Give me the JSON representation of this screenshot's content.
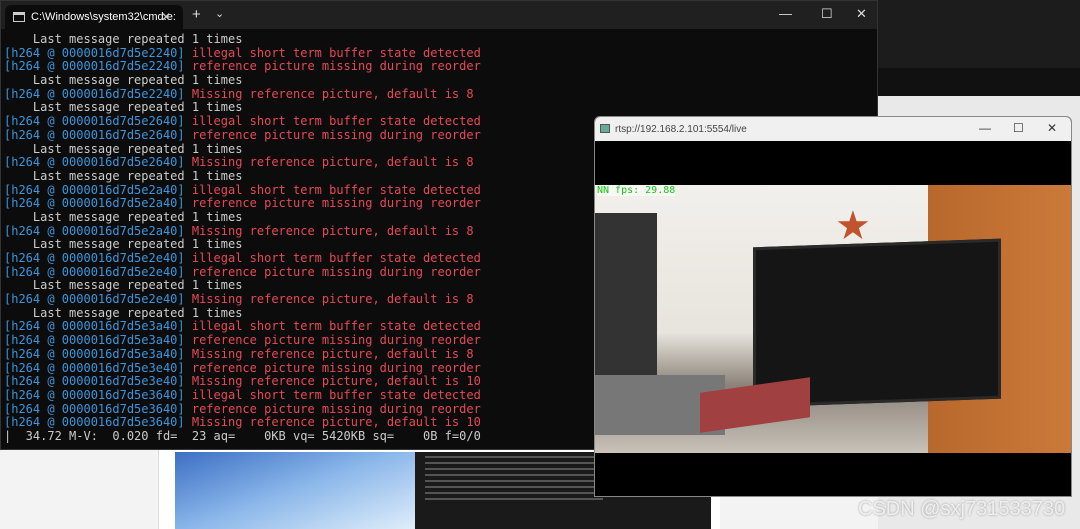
{
  "terminal": {
    "tab_title": "C:\\Windows\\system32\\cmd.e:",
    "lines": [
      {
        "p": "",
        "m": "",
        "g": "    Last message repeated 1 times"
      },
      {
        "p": "[h264 @ 0000016d7d5e2240] ",
        "m": "illegal short term buffer state detected",
        "g": ""
      },
      {
        "p": "[h264 @ 0000016d7d5e2240] ",
        "m": "reference picture missing during reorder",
        "g": ""
      },
      {
        "p": "",
        "m": "",
        "g": "    Last message repeated 1 times"
      },
      {
        "p": "[h264 @ 0000016d7d5e2240] ",
        "m": "Missing reference picture, default is 8",
        "g": ""
      },
      {
        "p": "",
        "m": "",
        "g": "    Last message repeated 1 times"
      },
      {
        "p": "[h264 @ 0000016d7d5e2640] ",
        "m": "illegal short term buffer state detected",
        "g": ""
      },
      {
        "p": "[h264 @ 0000016d7d5e2640] ",
        "m": "reference picture missing during reorder",
        "g": ""
      },
      {
        "p": "",
        "m": "",
        "g": "    Last message repeated 1 times"
      },
      {
        "p": "[h264 @ 0000016d7d5e2640] ",
        "m": "Missing reference picture, default is 8",
        "g": ""
      },
      {
        "p": "",
        "m": "",
        "g": "    Last message repeated 1 times"
      },
      {
        "p": "[h264 @ 0000016d7d5e2a40] ",
        "m": "illegal short term buffer state detected",
        "g": ""
      },
      {
        "p": "[h264 @ 0000016d7d5e2a40] ",
        "m": "reference picture missing during reorder",
        "g": ""
      },
      {
        "p": "",
        "m": "",
        "g": "    Last message repeated 1 times"
      },
      {
        "p": "[h264 @ 0000016d7d5e2a40] ",
        "m": "Missing reference picture, default is 8",
        "g": ""
      },
      {
        "p": "",
        "m": "",
        "g": "    Last message repeated 1 times"
      },
      {
        "p": "[h264 @ 0000016d7d5e2e40] ",
        "m": "illegal short term buffer state detected",
        "g": ""
      },
      {
        "p": "[h264 @ 0000016d7d5e2e40] ",
        "m": "reference picture missing during reorder",
        "g": ""
      },
      {
        "p": "",
        "m": "",
        "g": "    Last message repeated 1 times"
      },
      {
        "p": "[h264 @ 0000016d7d5e2e40] ",
        "m": "Missing reference picture, default is 8",
        "g": ""
      },
      {
        "p": "",
        "m": "",
        "g": "    Last message repeated 1 times"
      },
      {
        "p": "[h264 @ 0000016d7d5e3a40] ",
        "m": "illegal short term buffer state detected",
        "g": ""
      },
      {
        "p": "[h264 @ 0000016d7d5e3a40] ",
        "m": "reference picture missing during reorder",
        "g": ""
      },
      {
        "p": "[h264 @ 0000016d7d5e3a40] ",
        "m": "Missing reference picture, default is 8",
        "g": ""
      },
      {
        "p": "[h264 @ 0000016d7d5e3e40] ",
        "m": "reference picture missing during reorder",
        "g": ""
      },
      {
        "p": "[h264 @ 0000016d7d5e3e40] ",
        "m": "Missing reference picture, default is 10",
        "g": ""
      },
      {
        "p": "[h264 @ 0000016d7d5e3640] ",
        "m": "illegal short term buffer state detected",
        "g": ""
      },
      {
        "p": "[h264 @ 0000016d7d5e3640] ",
        "m": "reference picture missing during reorder",
        "g": ""
      },
      {
        "p": "[h264 @ 0000016d7d5e3640] ",
        "m": "Missing reference picture, default is 10",
        "g": ""
      },
      {
        "p": "",
        "m": "",
        "g": "|  34.72 M-V:  0.020 fd=  23 aq=    0KB vq= 5420KB sq=    0B f=0/0"
      }
    ]
  },
  "video_window": {
    "title": "rtsp://192.168.2.101:5554/live",
    "overlay": "NN fps: 29.88"
  },
  "watermark": "CSDN @sxj731533730"
}
